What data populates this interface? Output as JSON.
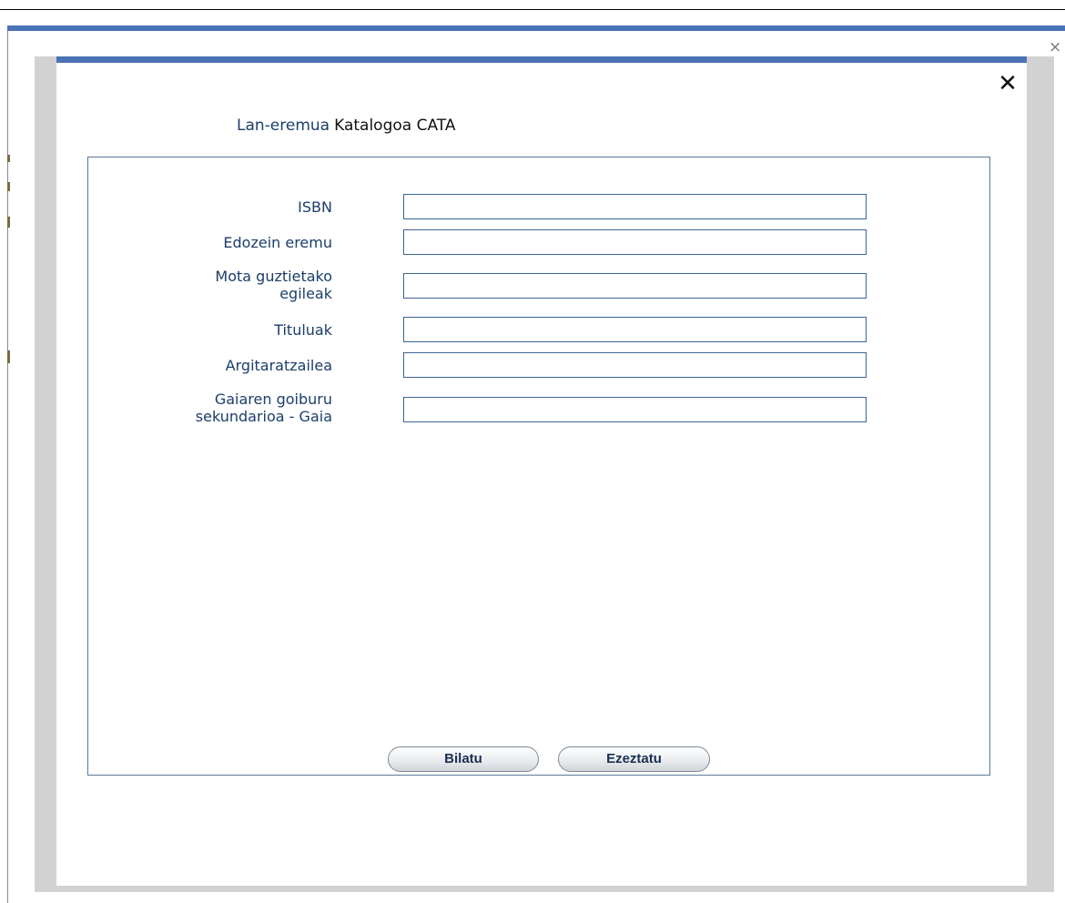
{
  "outer": {
    "close_glyph": "×"
  },
  "modal": {
    "close_glyph": "✕",
    "workspace_label": "Lan-eremua",
    "workspace_value": "Katalogoa CATA",
    "fields": [
      {
        "label": "ISBN",
        "value": ""
      },
      {
        "label": "Edozein eremu",
        "value": ""
      },
      {
        "label_line1": "Mota guztietako",
        "label_line2": "egileak",
        "value": ""
      },
      {
        "label": "Tituluak",
        "value": ""
      },
      {
        "label": "Argitaratzailea",
        "value": ""
      },
      {
        "label_line1": "Gaiaren goiburu",
        "label_line2": "sekundarioa - Gaia",
        "value": ""
      }
    ],
    "buttons": {
      "search_label": "Bilatu",
      "cancel_label": "Ezeztatu"
    }
  },
  "colors": {
    "accent_bar": "#4a73b5",
    "label_text": "#1a3e6b",
    "input_border": "#3d6592",
    "panel_border": "#5a7896"
  }
}
